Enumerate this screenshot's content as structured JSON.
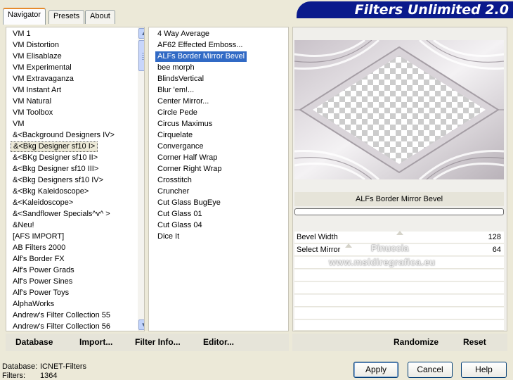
{
  "tabs": [
    {
      "label": "Navigator",
      "active": true
    },
    {
      "label": "Presets",
      "active": false
    },
    {
      "label": "About",
      "active": false
    }
  ],
  "app_title": "Filters Unlimited 2.0",
  "categories": {
    "items": [
      "VM 1",
      "VM Distortion",
      "VM Elisablaze",
      "VM Experimental",
      "VM Extravaganza",
      "VM Instant Art",
      "VM Natural",
      "VM Toolbox",
      "VM",
      "&<Background Designers IV>",
      "&<Bkg Designer sf10 I>",
      "&<BKg Designer sf10 II>",
      "&<Bkg Designer sf10 III>",
      "&<Bkg Designers sf10 IV>",
      "&<Bkg Kaleidoscope>",
      "&<Kaleidoscope>",
      "&<Sandflower Specials^v^ >",
      "&Neu!",
      "[AFS IMPORT]",
      "AB Filters 2000",
      "Alf's Border FX",
      "Alf's Power Grads",
      "Alf's Power Sines",
      "Alf's Power Toys",
      "AlphaWorks",
      "Andrew's Filter Collection 55",
      "Andrew's Filter Collection 56"
    ],
    "selected_index": 10
  },
  "filters": {
    "items": [
      "4 Way Average",
      "AF62 Effected Emboss...",
      "ALFs Border Mirror Bevel",
      "bee morph",
      "BlindsVertical",
      "Blur 'em!...",
      "Center Mirror...",
      "Circle Pede",
      "Circus Maximus",
      "Cirquelate",
      "Convergance",
      "Corner Half Wrap",
      "Corner Right Wrap",
      "Crosstitch",
      "Cruncher",
      "Cut Glass  BugEye",
      "Cut Glass 01",
      "Cut Glass 04",
      "Dice It"
    ],
    "selected_index": 2
  },
  "preview": {
    "filter_name": "ALFs Border Mirror Bevel",
    "progress": 0,
    "params": [
      {
        "label": "Bevel Width",
        "value": "128",
        "fraction": 0.5
      },
      {
        "label": "Select Mirror",
        "value": "64",
        "fraction": 0.25
      }
    ]
  },
  "watermarks": {
    "line1": "Pinuccia",
    "line2": "www.msldiregrafica.eu"
  },
  "links": {
    "database": "Database",
    "import": "Import...",
    "filter_info": "Filter Info...",
    "editor": "Editor...",
    "randomize": "Randomize",
    "reset": "Reset"
  },
  "status": {
    "database_label": "Database:",
    "database_value": "ICNET-Filters",
    "filters_label": "Filters:",
    "filters_value": "1364"
  },
  "buttons": {
    "apply": "Apply",
    "cancel": "Cancel",
    "help": "Help"
  },
  "colors": {
    "banner": "#0a1a8c",
    "selection": "#316ac5",
    "tab_accent": "#e68b2c"
  }
}
